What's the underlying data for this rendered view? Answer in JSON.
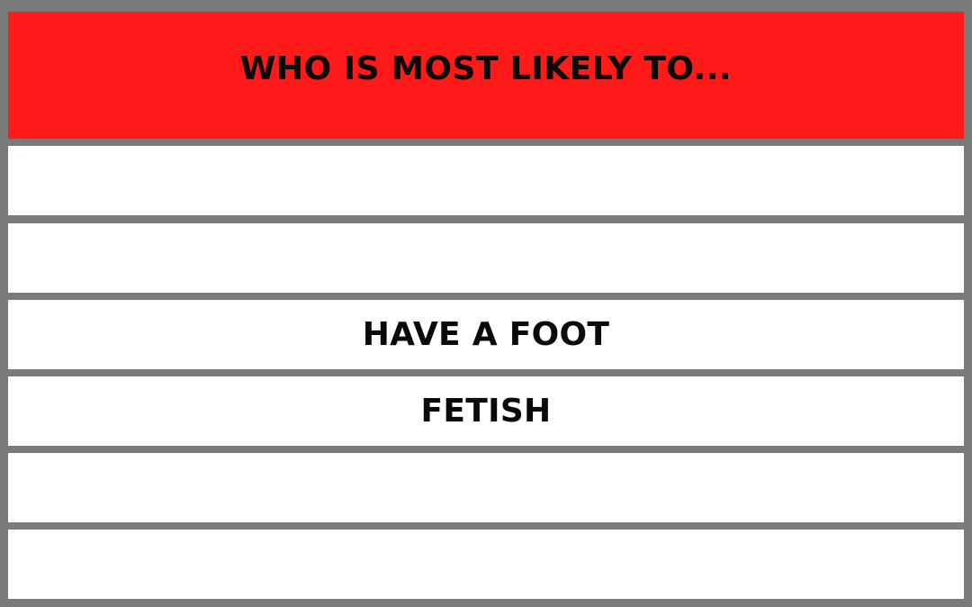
{
  "header": {
    "title": "WHO IS MOST LIKELY TO...",
    "background_color": "#ff1a1a"
  },
  "rows": [
    {
      "text": ""
    },
    {
      "text": ""
    },
    {
      "text": "HAVE A FOOT"
    },
    {
      "text": "FETISH"
    },
    {
      "text": ""
    },
    {
      "text": ""
    }
  ],
  "colors": {
    "border": "#7a7a7a",
    "row_background": "#ffffff",
    "text": "#0a0a0a"
  }
}
